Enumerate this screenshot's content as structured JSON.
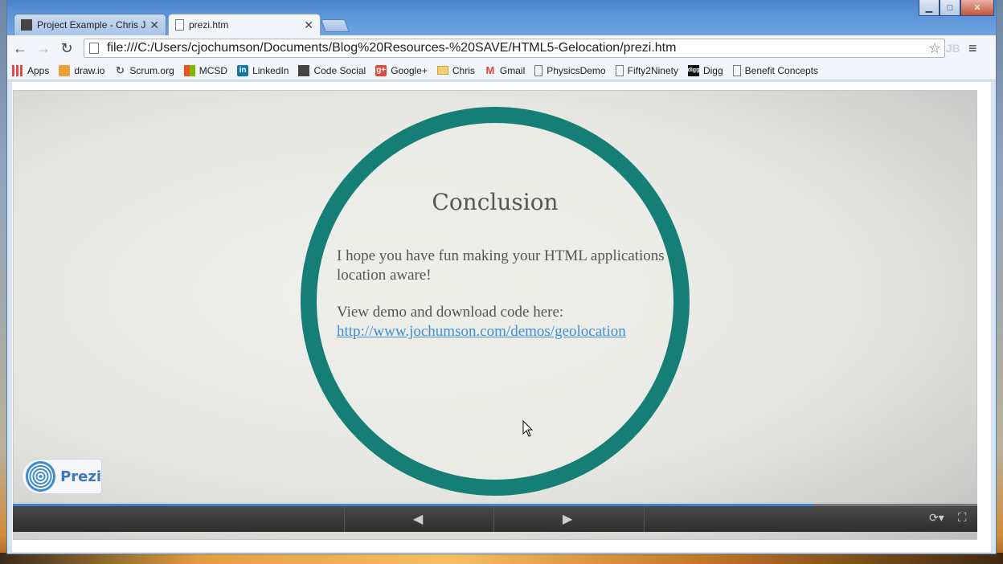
{
  "tabs": [
    {
      "title": "Project Example - Chris Jochumson",
      "active": false
    },
    {
      "title": "prezi.htm",
      "active": true
    }
  ],
  "window_controls": {
    "minimize": "▁",
    "maximize": "□",
    "close": "✕"
  },
  "toolbar": {
    "url": "file:///C:/Users/cjochumson/Documents/Blog%20Resources-%20SAVE/HTML5-Gelocation/prezi.htm",
    "extension_label": "JB"
  },
  "bookmarks": [
    {
      "label": "Apps",
      "icon": "apps-grid-icon"
    },
    {
      "label": "draw.io",
      "icon": "drawio-icon"
    },
    {
      "label": "Scrum.org",
      "icon": "scrum-icon"
    },
    {
      "label": "MCSD",
      "icon": "microsoft-icon"
    },
    {
      "label": "LinkedIn",
      "icon": "linkedin-icon"
    },
    {
      "label": "Code Social",
      "icon": "code-social-icon"
    },
    {
      "label": "Google+",
      "icon": "googleplus-icon"
    },
    {
      "label": "Chris",
      "icon": "folder-icon"
    },
    {
      "label": "Gmail",
      "icon": "gmail-icon"
    },
    {
      "label": "PhysicsDemo",
      "icon": "page-icon"
    },
    {
      "label": "Fifty2Ninety",
      "icon": "page-icon"
    },
    {
      "label": "Digg",
      "icon": "digg-icon"
    },
    {
      "label": "Benefit Concepts",
      "icon": "page-icon"
    }
  ],
  "slide": {
    "title": "Conclusion",
    "paragraph1": "I hope you have fun making your HTML applications location aware!",
    "paragraph2": "View demo and download code here:",
    "link": "http://www.jochumson.com/demos/geolocation"
  },
  "prezi": {
    "logo_text": "Prezi",
    "progress_fraction": 0.83
  },
  "colors": {
    "ring": "#167f75",
    "link": "#3d8fd6",
    "progress": "#3b83d8"
  }
}
